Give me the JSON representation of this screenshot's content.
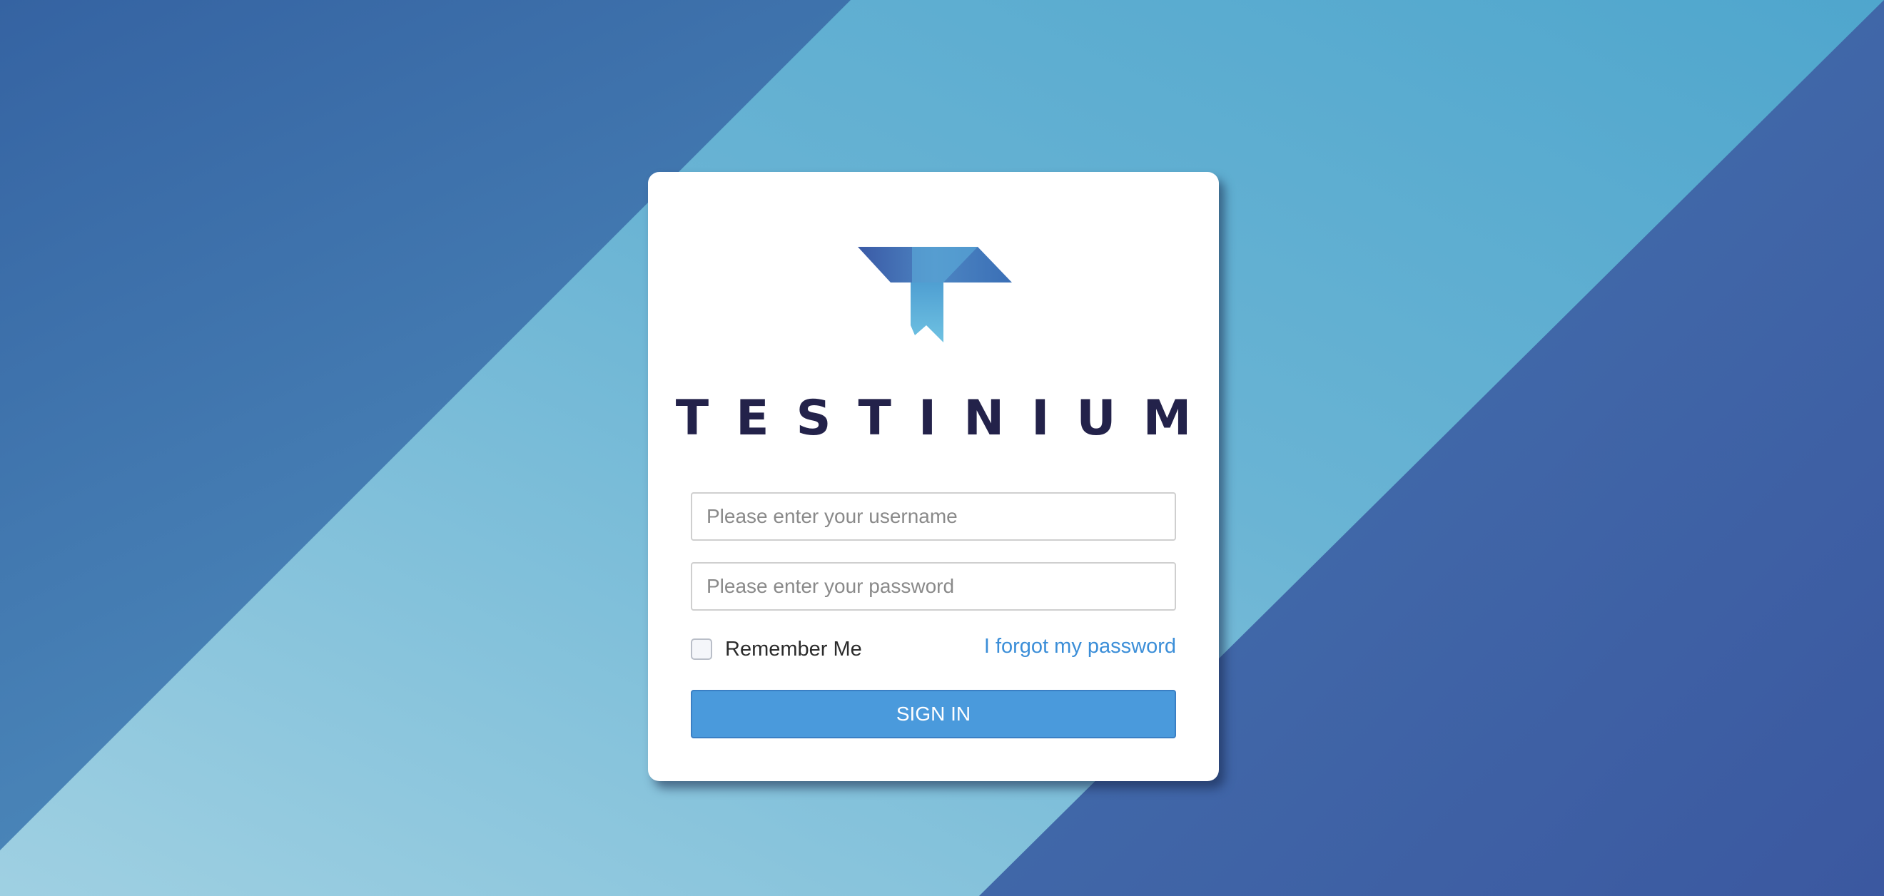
{
  "brand": {
    "logo_icon": "testinium-t-logo-icon",
    "name": "TESTINIUM"
  },
  "login": {
    "username_placeholder": "Please enter your username",
    "username_value": "",
    "password_placeholder": "Please enter your password",
    "password_value": "",
    "remember_label": "Remember Me",
    "remember_checked": false,
    "forgot_label": "I forgot my password",
    "signin_label": "SIGN IN"
  },
  "colors": {
    "background_dark": "#3a5ea4",
    "background_light": "#8cc6dc",
    "brand_text": "#23224a",
    "link": "#3b8ed8",
    "button": "#4a9adc"
  }
}
